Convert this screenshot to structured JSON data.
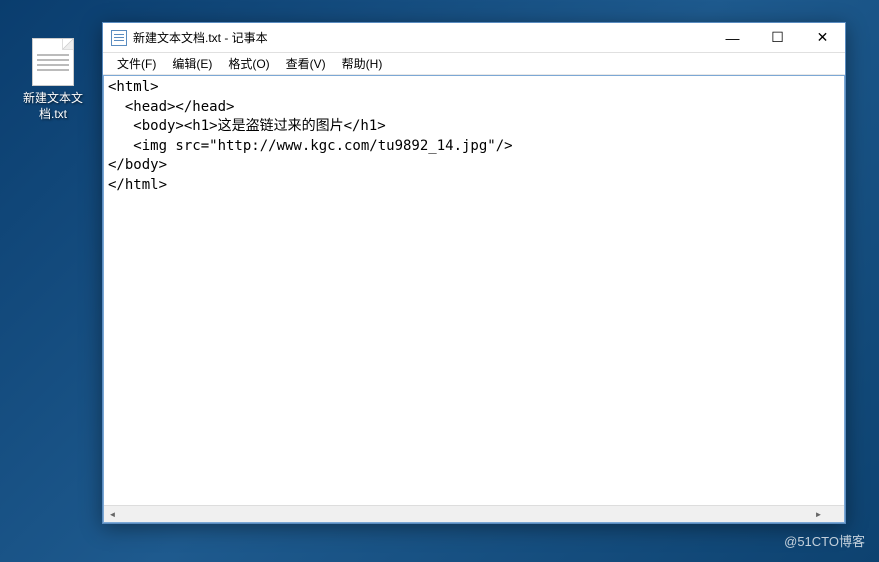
{
  "desktop": {
    "icon_label": "新建文本文\n档.txt"
  },
  "window": {
    "title": "新建文本文档.txt - 记事本",
    "controls": {
      "minimize": "—",
      "maximize": "☐",
      "close": "✕"
    }
  },
  "menubar": {
    "file": "文件(F)",
    "edit": "编辑(E)",
    "format": "格式(O)",
    "view": "查看(V)",
    "help": "帮助(H)"
  },
  "editor": {
    "content": "<html>\n  <head></head>\n   <body><h1>这是盗链过来的图片</h1>\n   <img src=\"http://www.kgc.com/tu9892_14.jpg\"/>\n</body>\n</html>"
  },
  "watermark": "@51CTO博客"
}
